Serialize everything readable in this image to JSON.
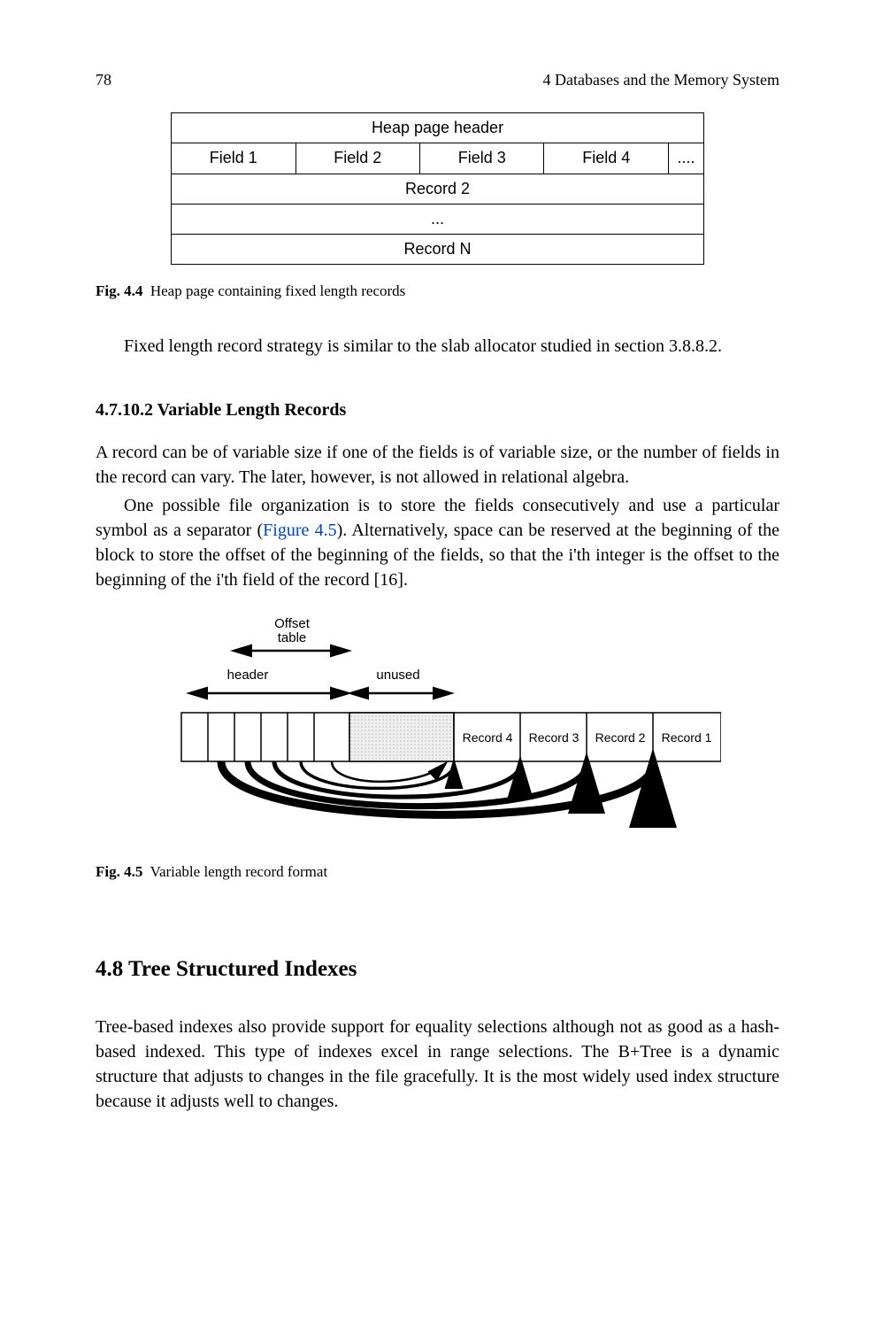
{
  "header": {
    "page_number": "78",
    "running_title": "4  Databases and the Memory System"
  },
  "fig44": {
    "row0": "Heap page header",
    "fields": [
      "Field 1",
      "Field 2",
      "Field 3",
      "Field 4",
      "...."
    ],
    "row_record2": "Record 2",
    "row_ellipsis": "...",
    "row_recordN": "Record N",
    "caption_label": "Fig. 4.4",
    "caption_text": "Heap page containing fixed length records"
  },
  "body": {
    "p1": "Fixed length record strategy is similar to the slab allocator studied in section 3.8.8.2.",
    "sub_heading": "4.7.10.2  Variable Length Records",
    "p2": "A record can be of variable size if one of the fields is of variable size, or the number of fields in the record can vary. The later, however, is not allowed in relational algebra.",
    "p3a": "One possible file organization is to store the fields consecutively and use a particular symbol as a separator (",
    "p3_link": "Figure 4.5",
    "p3b": "). Alternatively, space can be reserved at the beginning of the block to store the offset of the beginning of the fields, so that the i'th integer is the offset to the beginning of the i'th field of the record [16]."
  },
  "fig45": {
    "label_offset_table": "Offset\ntable",
    "label_header": "header",
    "label_unused": "unused",
    "records": [
      "Record 4",
      "Record 3",
      "Record 2",
      "Record 1"
    ],
    "caption_label": "Fig. 4.5",
    "caption_text": "Variable length record format"
  },
  "section48": {
    "heading": "4.8 Tree Structured Indexes",
    "p": "Tree-based indexes also provide support for equality selections although not as good as a hash-based indexed. This type of indexes excel in range selections. The B+Tree is a dynamic structure that adjusts to changes in the file gracefully. It is the most widely used index structure because it adjusts well to changes."
  }
}
